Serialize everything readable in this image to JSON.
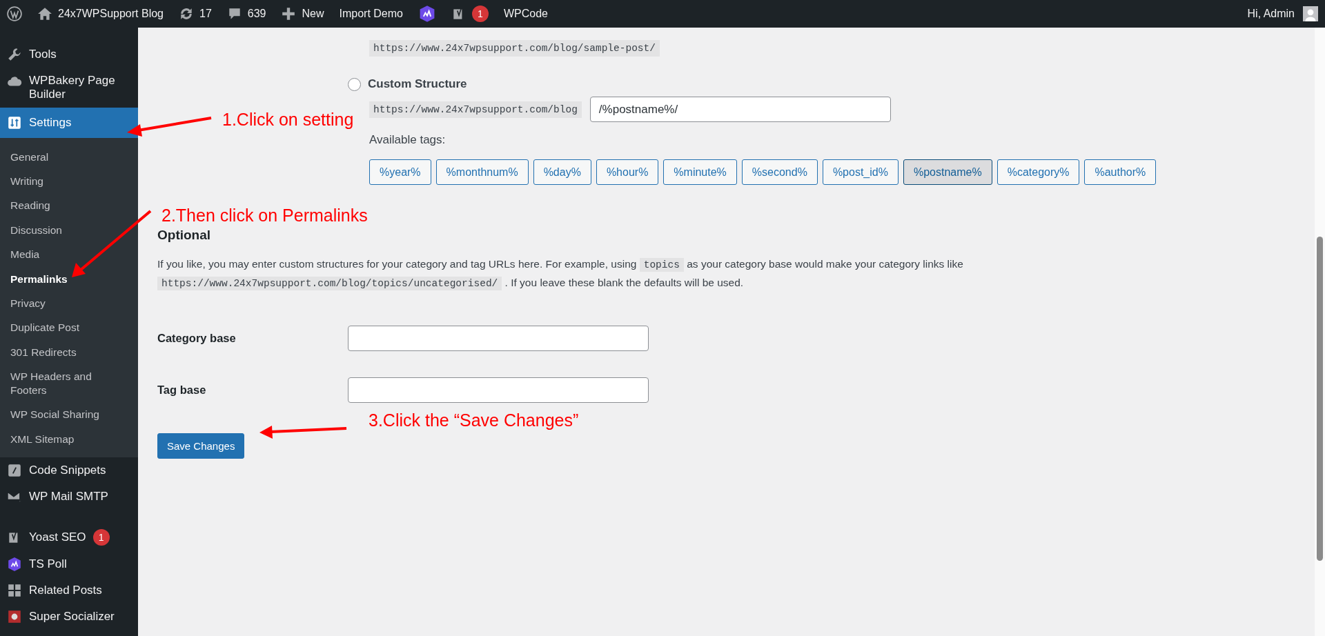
{
  "admin_bar": {
    "site_name": "24x7WPSupport Blog",
    "updates": "17",
    "comments": "639",
    "new_label": "New",
    "items": [
      "Import Demo"
    ],
    "yoast_badge": "1",
    "wpcode": "WPCode",
    "greeting": "Hi, Admin"
  },
  "sidebar": {
    "items": [
      {
        "label": "Tools",
        "selected": false
      },
      {
        "label": "WPBakery Page Builder",
        "selected": false
      },
      {
        "label": "Settings",
        "selected": true,
        "children": [
          {
            "label": "General",
            "selected": false
          },
          {
            "label": "Writing",
            "selected": false
          },
          {
            "label": "Reading",
            "selected": false
          },
          {
            "label": "Discussion",
            "selected": false
          },
          {
            "label": "Media",
            "selected": false
          },
          {
            "label": "Permalinks",
            "selected": true
          },
          {
            "label": "Privacy",
            "selected": false
          },
          {
            "label": "Duplicate Post",
            "selected": false
          },
          {
            "label": "301 Redirects",
            "selected": false
          },
          {
            "label": "WP Headers and Footers",
            "selected": false
          },
          {
            "label": "WP Social Sharing",
            "selected": false
          },
          {
            "label": "XML Sitemap",
            "selected": false
          }
        ]
      },
      {
        "label": "Code Snippets",
        "selected": false
      },
      {
        "label": "WP Mail SMTP",
        "selected": false
      },
      {
        "label": "Yoast SEO",
        "selected": false,
        "badge": "1"
      },
      {
        "label": "TS Poll",
        "selected": false
      },
      {
        "label": "Related Posts",
        "selected": false
      },
      {
        "label": "Super Socializer",
        "selected": false
      }
    ]
  },
  "permalinks": {
    "sample_url": "https://www.24x7wpsupport.com/blog/sample-post/",
    "custom_structure": {
      "label": "Custom Structure",
      "checked": false,
      "prefix": "https://www.24x7wpsupport.com/blog",
      "value": "/%postname%/"
    },
    "available_tags_label": "Available tags:",
    "tags": [
      {
        "label": "%year%",
        "selected": false
      },
      {
        "label": "%monthnum%",
        "selected": false
      },
      {
        "label": "%day%",
        "selected": false
      },
      {
        "label": "%hour%",
        "selected": false
      },
      {
        "label": "%minute%",
        "selected": false
      },
      {
        "label": "%second%",
        "selected": false
      },
      {
        "label": "%post_id%",
        "selected": false
      },
      {
        "label": "%postname%",
        "selected": true
      },
      {
        "label": "%category%",
        "selected": false
      },
      {
        "label": "%author%",
        "selected": false
      }
    ]
  },
  "optional": {
    "title": "Optional",
    "description": [
      {
        "kind": "text",
        "text": "If you like, you may enter custom structures for your category and tag URLs here. For example, using "
      },
      {
        "kind": "code",
        "text": "topics"
      },
      {
        "kind": "text",
        "text": " as your category base would make your category links like "
      },
      {
        "kind": "code",
        "text": "https://www.24x7wpsupport.com/blog/topics/uncategorised/"
      },
      {
        "kind": "text",
        "text": " . If you leave these blank the defaults will be used."
      }
    ],
    "fields": [
      {
        "label": "Category base"
      },
      {
        "label": "Tag base"
      }
    ]
  },
  "save_button": "Save Changes",
  "annotations": [
    "1.Click on setting",
    "2.Then click on Permalinks",
    "3.Click the “Save Changes”"
  ]
}
